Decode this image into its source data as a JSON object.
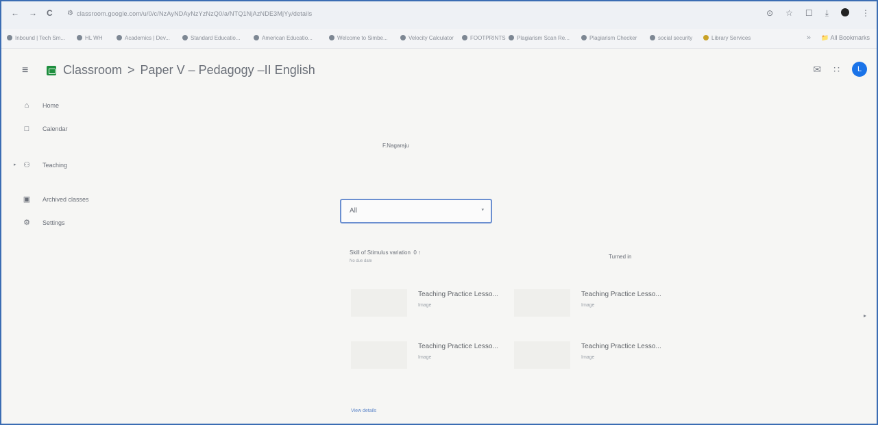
{
  "browser": {
    "nav": {
      "back": "←",
      "forward": "→",
      "reload": "C"
    },
    "url": "classroom.google.com/u/0/c/NzAyNDAyNzYzNzQ0/a/NTQ1NjAzNDE3MjYy/details",
    "right_icons": [
      "⊙",
      "☆",
      "☐",
      "⤓"
    ],
    "bookmarks": [
      "Inbound | Tech Sm...",
      "HL WH",
      "Academics | Dev...",
      "Standard Educatio...",
      "American Educatio...",
      "Welcome to Simbe...",
      "Velocity Calculator",
      "FOOTPRINTS",
      "Plagiarism Scan Re...",
      "Plagiarism Checker",
      "social security",
      "Library Services"
    ],
    "all_bookmarks": "All Bookmarks"
  },
  "header": {
    "app_name": "Classroom",
    "separator": ">",
    "class_name": "Paper V – Pedagogy –II English",
    "right_icons": [
      "✉",
      "∷"
    ],
    "avatar_letter": "L"
  },
  "sidebar": {
    "items": [
      {
        "label": "Home",
        "icon": "⌂"
      },
      {
        "label": "Calendar",
        "icon": "□"
      },
      {
        "label": "Teaching",
        "icon": "⚇"
      },
      {
        "label": "Archived classes",
        "icon": "▣"
      },
      {
        "label": "Settings",
        "icon": "⚙"
      }
    ]
  },
  "main": {
    "pages": "F.Nagaraju",
    "filter": {
      "value": "All",
      "arrow": "▾"
    },
    "assignment": {
      "title": "Skill of Stimulus variation",
      "count": "0 ↑",
      "due": "No due date",
      "status": "Turned in"
    },
    "attachments": [
      {
        "title": "Teaching Practice Lesso...",
        "type": "Image"
      },
      {
        "title": "Teaching Practice Lesso...",
        "type": "Image"
      },
      {
        "title": "Teaching Practice Lesso...",
        "type": "Image"
      },
      {
        "title": "Teaching Practice Lesso...",
        "type": "Image"
      }
    ],
    "view_details": "View details"
  }
}
